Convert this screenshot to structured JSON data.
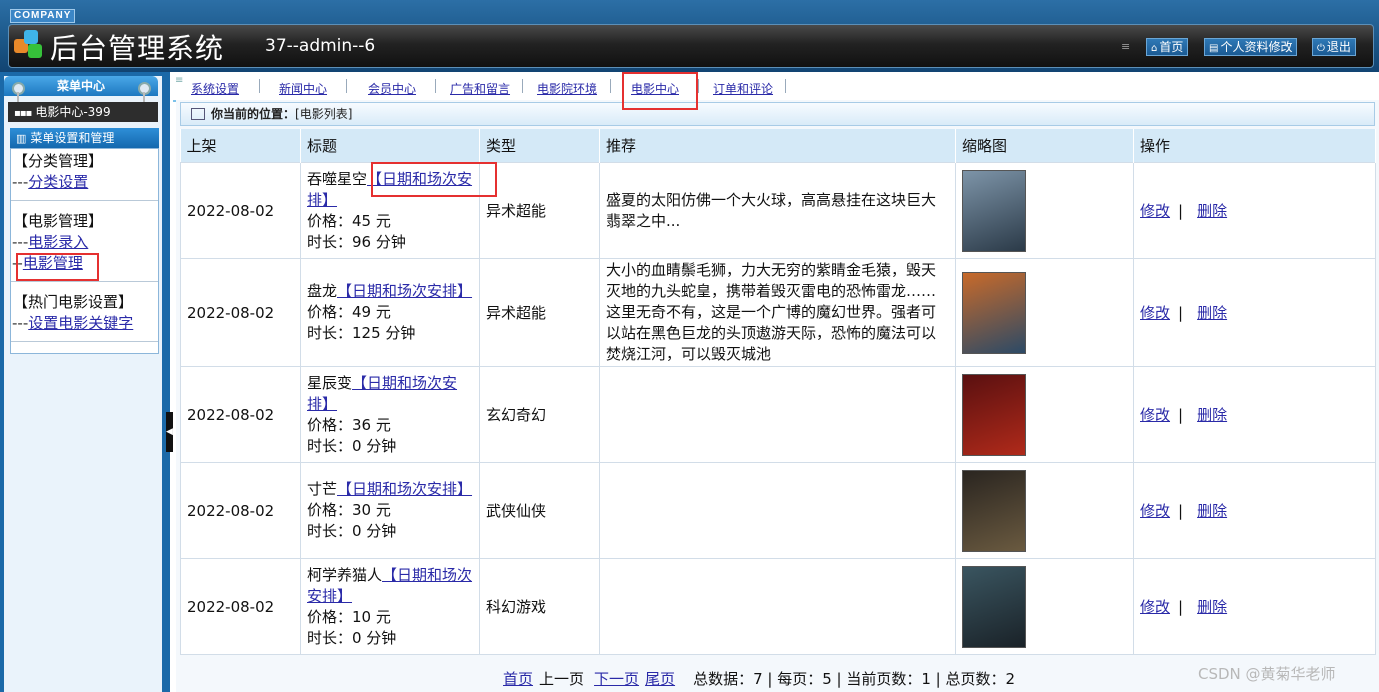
{
  "header": {
    "company": "COMPANY",
    "title": "后台管理系统",
    "user": "37--admin--6",
    "buttons": [
      {
        "icon": "home-icon",
        "glyph": "⌂",
        "label": "首页"
      },
      {
        "icon": "profile-icon",
        "glyph": "▤",
        "label": "个人资料修改"
      },
      {
        "icon": "power-icon",
        "glyph": "⏻",
        "label": "退出"
      }
    ]
  },
  "sidebar": {
    "menu_center": "菜单中心",
    "movie_center": "电影中心-399",
    "settings_head": "菜单设置和管理",
    "groups": [
      {
        "title": "【分类管理】",
        "items": [
          {
            "prefix": "---",
            "label": "分类设置"
          }
        ]
      },
      {
        "title": "【电影管理】",
        "items": [
          {
            "prefix": "---",
            "label": "电影录入"
          },
          {
            "prefix": "--",
            "label": "电影管理"
          }
        ]
      },
      {
        "title": "【热门电影设置】",
        "items": [
          {
            "prefix": "---",
            "label": "设置电影关键字"
          }
        ]
      }
    ]
  },
  "nav": {
    "tabs": [
      "系统设置",
      "新闻中心",
      "会员中心",
      "广告和留言",
      "电影院环境",
      "电影中心",
      "订单和评论"
    ],
    "active": "电影中心"
  },
  "location": {
    "label": "你当前的位置：",
    "value": "[电影列表]"
  },
  "table": {
    "headers": [
      "上架",
      "标题",
      "类型",
      "推荐",
      "缩略图",
      "操作"
    ],
    "rows": [
      {
        "date": "2022-08-02",
        "name": "吞噬星空",
        "schedule": "【日期和场次安排】",
        "price": "价格：45 元",
        "duration": "时长：96 分钟",
        "type": "异术超能",
        "recommend": "盛夏的太阳仿佛一个大火球，高高悬挂在这块巨大翡翠之中...",
        "edit": "修改",
        "sep": "|",
        "del": "删除"
      },
      {
        "date": "2022-08-02",
        "name": "盘龙",
        "schedule": "【日期和场次安排】",
        "price": "价格：49 元",
        "duration": "时长：125 分钟",
        "type": "异术超能",
        "recommend": "大小的血睛鬃毛狮，力大无穷的紫睛金毛猿，毁天灭地的九头蛇皇，携带着毁灭雷电的恐怖雷龙……这里无奇不有，这是一个广博的魔幻世界。强者可以站在黑色巨龙的头顶遨游天际，恐怖的魔法可以焚烧江河，可以毁灭城池",
        "edit": "修改",
        "sep": "|",
        "del": "删除"
      },
      {
        "date": "2022-08-02",
        "name": "星辰变",
        "schedule": "【日期和场次安排】",
        "price": "价格：36 元",
        "duration": "时长：0 分钟",
        "type": "玄幻奇幻",
        "recommend": "",
        "edit": "修改",
        "sep": "|",
        "del": "删除"
      },
      {
        "date": "2022-08-02",
        "name": "寸芒",
        "schedule": "【日期和场次安排】",
        "price": "价格：30 元",
        "duration": "时长：0 分钟",
        "type": "武侠仙侠",
        "recommend": "",
        "edit": "修改",
        "sep": "|",
        "del": "删除"
      },
      {
        "date": "2022-08-02",
        "name": "柯学养猫人",
        "schedule": "【日期和场次安排】",
        "price": "价格：10 元",
        "duration": "时长：0 分钟",
        "type": "科幻游戏",
        "recommend": "",
        "edit": "修改",
        "sep": "|",
        "del": "删除"
      }
    ],
    "poster_colors": [
      [
        "#7d94a8",
        "#2b3a48"
      ],
      [
        "#c86a2a",
        "#2c4a66"
      ],
      [
        "#5a1010",
        "#b02a1a"
      ],
      [
        "#2a2520",
        "#6a5a40"
      ],
      [
        "#3a5560",
        "#1a2228"
      ]
    ]
  },
  "pager": {
    "first": "首页",
    "prev": "上一页",
    "next": "下一页",
    "last": "尾页",
    "stats": "总数据：7 | 每页：5 | 当前页数：1 | 总页数：2"
  },
  "watermark": "CSDN @黄菊华老师",
  "accent": {
    "highlight": "#e53030",
    "header": "#1a5586"
  }
}
